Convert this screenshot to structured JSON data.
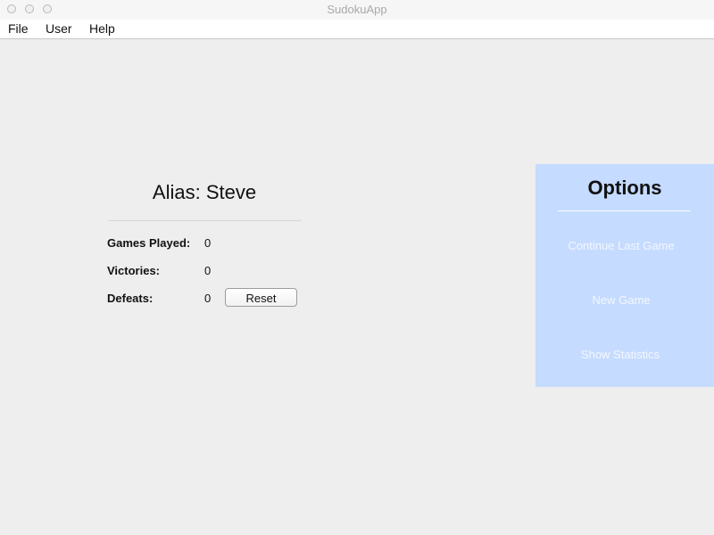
{
  "window": {
    "title": "SudokuApp"
  },
  "menubar": {
    "items": [
      {
        "label": "File"
      },
      {
        "label": "User"
      },
      {
        "label": "Help"
      }
    ]
  },
  "profile": {
    "alias": "Alias: Steve",
    "stats": [
      {
        "label": "Games Played:",
        "value": "0"
      },
      {
        "label": "Victories:",
        "value": "0"
      },
      {
        "label": "Defeats:",
        "value": "0"
      }
    ],
    "reset_label": "Reset"
  },
  "options": {
    "title": "Options",
    "items": [
      {
        "label": "Continue Last Game"
      },
      {
        "label": "New Game"
      },
      {
        "label": "Show Statistics"
      }
    ],
    "panel_color": "#c5dbff"
  }
}
